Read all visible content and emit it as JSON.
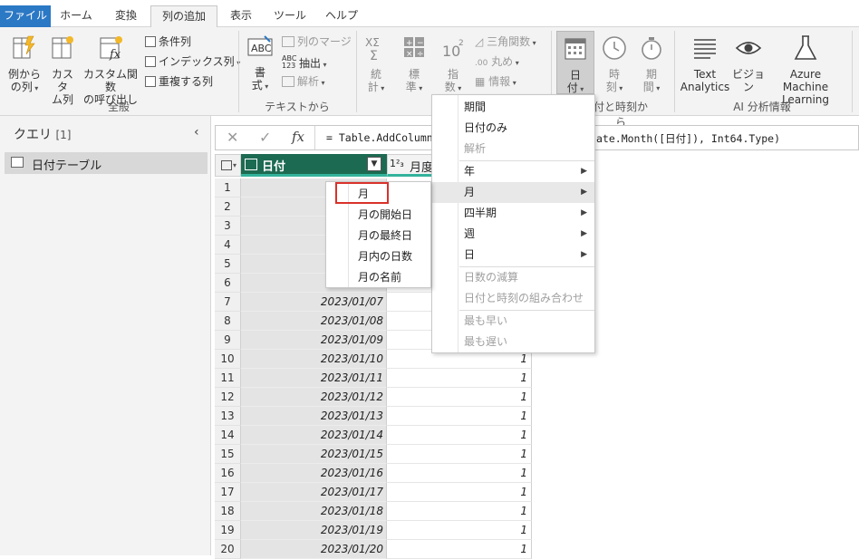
{
  "tabs": [
    "ファイル",
    "ホーム",
    "変換",
    "列の追加",
    "表示",
    "ツール",
    "ヘルプ"
  ],
  "ribbon": {
    "general": {
      "label": "全般",
      "example_col": [
        "例から",
        "の列"
      ],
      "custom_col": [
        "カスタ",
        "ム列"
      ],
      "custom_func": [
        "カスタム関数",
        "の呼び出し"
      ],
      "conditional": "条件列",
      "index": "インデックス列",
      "duplicate": "重複する列"
    },
    "text": {
      "label": "テキストから",
      "format": [
        "書",
        "式"
      ],
      "merge": "列のマージ",
      "extract": "抽出",
      "parse": "解析"
    },
    "number": {
      "stats": [
        "統",
        "計"
      ],
      "standard": [
        "標",
        "準"
      ],
      "sci": [
        "指",
        "数"
      ],
      "trig": "三角関数",
      "round": "丸め",
      "info": "情報"
    },
    "datetime": {
      "label": "付と時刻から",
      "date": [
        "日",
        "付"
      ],
      "time": [
        "時",
        "刻"
      ],
      "duration": [
        "期",
        "間"
      ]
    },
    "ai": {
      "label": "AI 分析情報",
      "text_analytics": [
        "Text",
        "Analytics"
      ],
      "vision": [
        "ビジョ",
        "ン"
      ],
      "azure_ml": [
        "Azure Machine",
        "Learning"
      ]
    }
  },
  "queries": {
    "title": "クエリ",
    "count": "[1]",
    "items": [
      "日付テーブル"
    ]
  },
  "formula": {
    "fx": "fx",
    "text_left": "= Table.AddColumn(",
    "text_right": "ate.Month([日付]), Int64.Type)"
  },
  "grid": {
    "col1": "日付",
    "col2_type": "1²₃",
    "col2": "月度",
    "rows": [
      {
        "n": "1",
        "date": "",
        "val": ""
      },
      {
        "n": "2",
        "date": "",
        "val": ""
      },
      {
        "n": "3",
        "date": "",
        "val": ""
      },
      {
        "n": "4",
        "date": "",
        "val": ""
      },
      {
        "n": "5",
        "date": "",
        "val": ""
      },
      {
        "n": "6",
        "date": "",
        "val": ""
      },
      {
        "n": "7",
        "date": "2023/01/07",
        "val": ""
      },
      {
        "n": "8",
        "date": "2023/01/08",
        "val": ""
      },
      {
        "n": "9",
        "date": "2023/01/09",
        "val": ""
      },
      {
        "n": "10",
        "date": "2023/01/10",
        "val": "1"
      },
      {
        "n": "11",
        "date": "2023/01/11",
        "val": "1"
      },
      {
        "n": "12",
        "date": "2023/01/12",
        "val": "1"
      },
      {
        "n": "13",
        "date": "2023/01/13",
        "val": "1"
      },
      {
        "n": "14",
        "date": "2023/01/14",
        "val": "1"
      },
      {
        "n": "15",
        "date": "2023/01/15",
        "val": "1"
      },
      {
        "n": "16",
        "date": "2023/01/16",
        "val": "1"
      },
      {
        "n": "17",
        "date": "2023/01/17",
        "val": "1"
      },
      {
        "n": "18",
        "date": "2023/01/18",
        "val": "1"
      },
      {
        "n": "19",
        "date": "2023/01/19",
        "val": "1"
      },
      {
        "n": "20",
        "date": "2023/01/20",
        "val": "1"
      }
    ]
  },
  "date_menu": {
    "items": [
      "期間",
      "日付のみ",
      "解析",
      "年",
      "月",
      "四半期",
      "週",
      "日",
      "日数の減算",
      "日付と時刻の組み合わせ",
      "最も早い",
      "最も遅い"
    ]
  },
  "month_menu": {
    "items": [
      "月",
      "月の開始日",
      "月の最終日",
      "月内の日数",
      "月の名前"
    ]
  },
  "colors": {
    "file_tab": "#2b78c5",
    "header_green": "#1d6a52",
    "highlight_red": "#d9312b"
  }
}
